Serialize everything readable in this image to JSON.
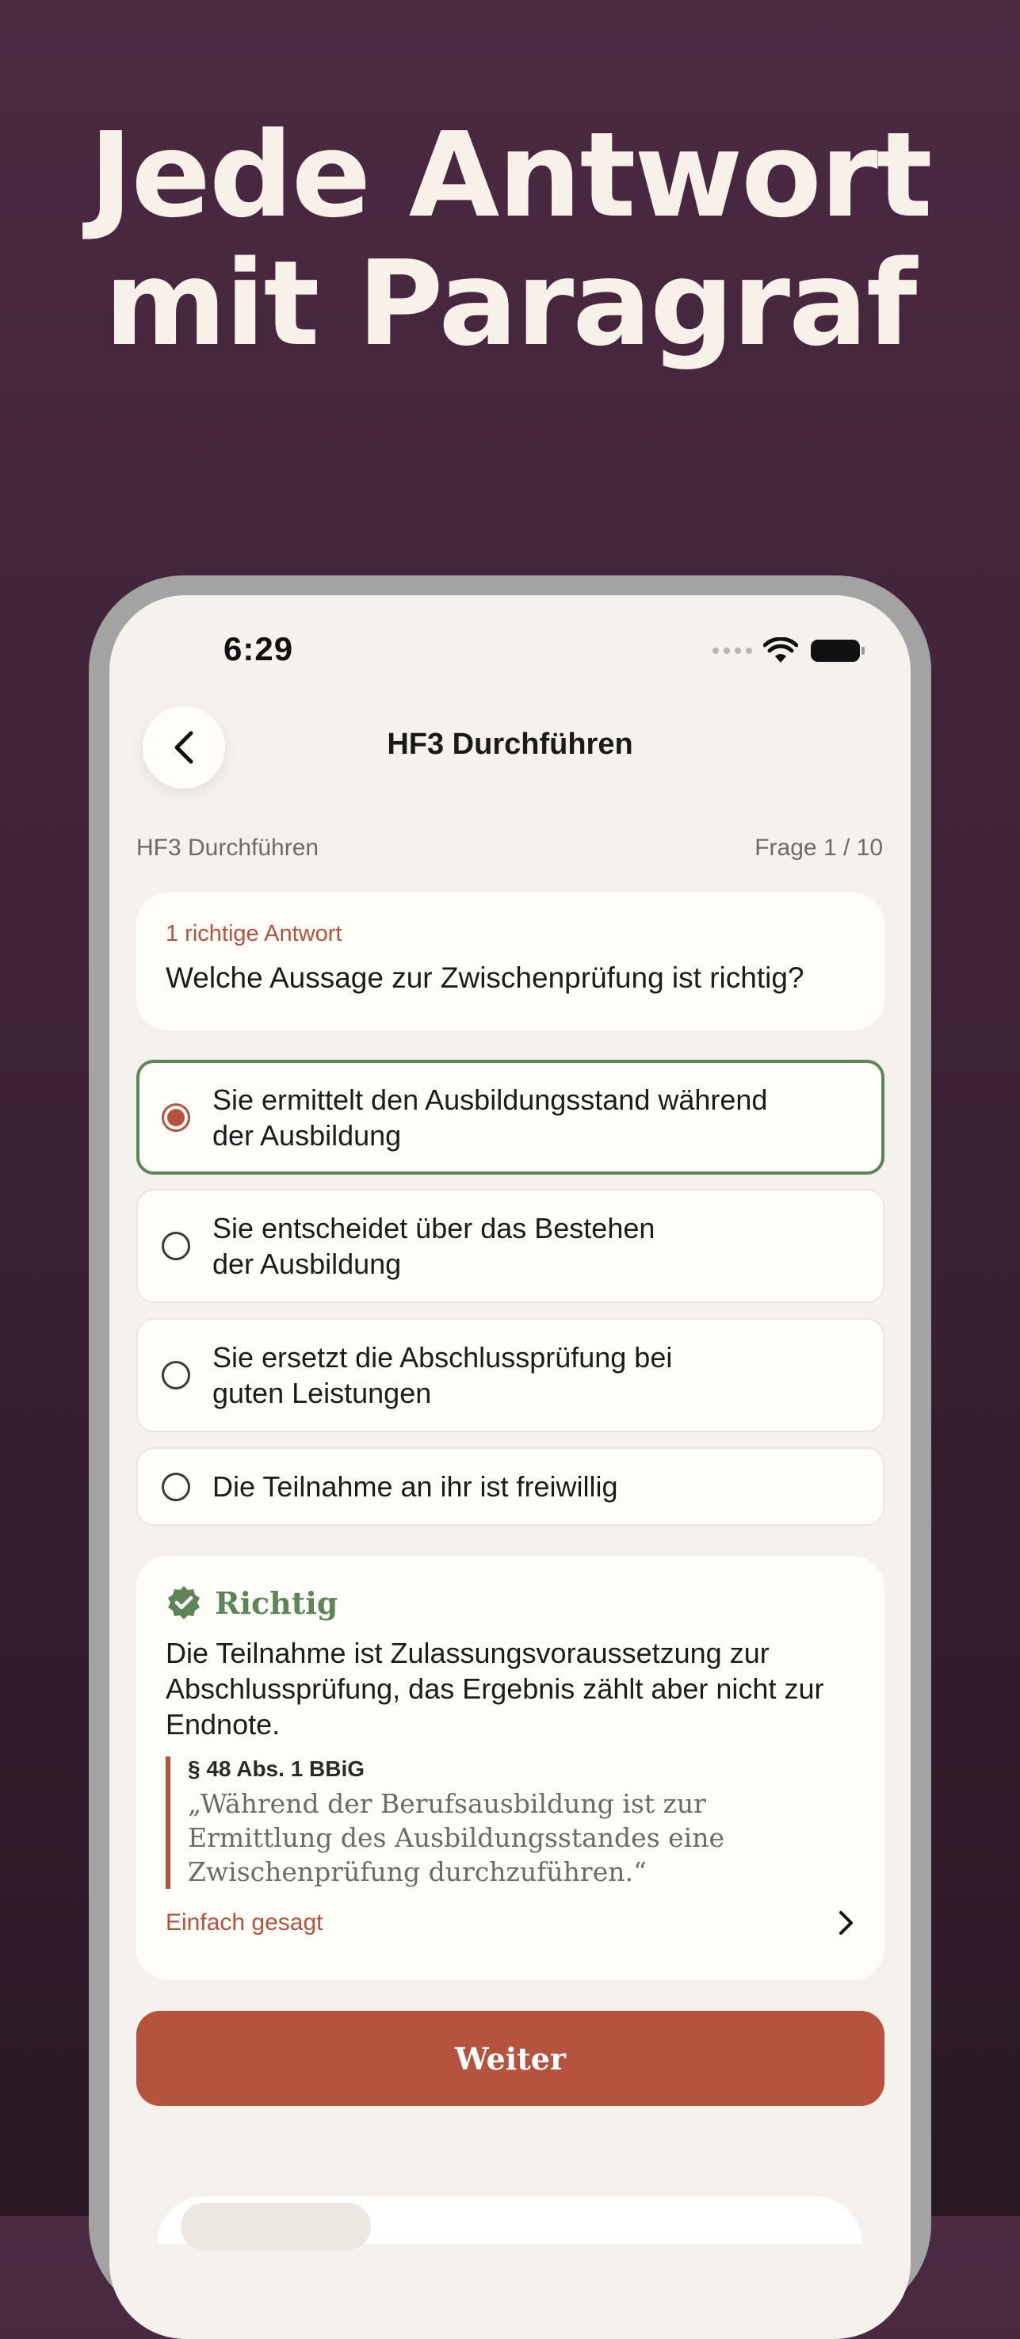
{
  "headline": {
    "line1": "Jede Antwort",
    "line2": "mit Paragraf"
  },
  "status_bar": {
    "time": "6:29"
  },
  "nav": {
    "title": "HF3 Durchführen",
    "back_icon": "chevron-left-icon"
  },
  "meta": {
    "module": "HF3 Durchführen",
    "progress": "Frage 1 / 10"
  },
  "question": {
    "hint": "1 richtige Antwort",
    "text": "Welche Aussage zur Zwischenprüfung ist richtig?"
  },
  "options": [
    {
      "line1": "Sie ermittelt den Ausbildungsstand während",
      "line2": "der Ausbildung",
      "selected": true
    },
    {
      "line1": "Sie entscheidet über das Bestehen",
      "line2": "der Ausbildung",
      "selected": false
    },
    {
      "line1": "Sie ersetzt die Abschlussprüfung bei",
      "line2": "guten Leistungen",
      "selected": false
    },
    {
      "line1": "Die Teilnahme an ihr ist freiwillig",
      "line2": "",
      "selected": false
    }
  ],
  "feedback": {
    "title": "Richtig",
    "text": "Die Teilnahme ist Zulassungsvoraussetzung zur Abschlussprüfung, das Ergebnis zählt aber nicht zur Endnote.",
    "law_ref": "§ 48 Abs. 1 BBiG",
    "law_quote": "„Während der Berufsausbildung ist zur Ermittlung des Ausbildungsstandes eine Zwischenprüfung durchzuführen.“",
    "simple_link": "Einfach gesagt"
  },
  "next_button": "Weiter",
  "colors": {
    "accent": "#b6533f",
    "success": "#5e8459",
    "background": "#4b2a42"
  }
}
